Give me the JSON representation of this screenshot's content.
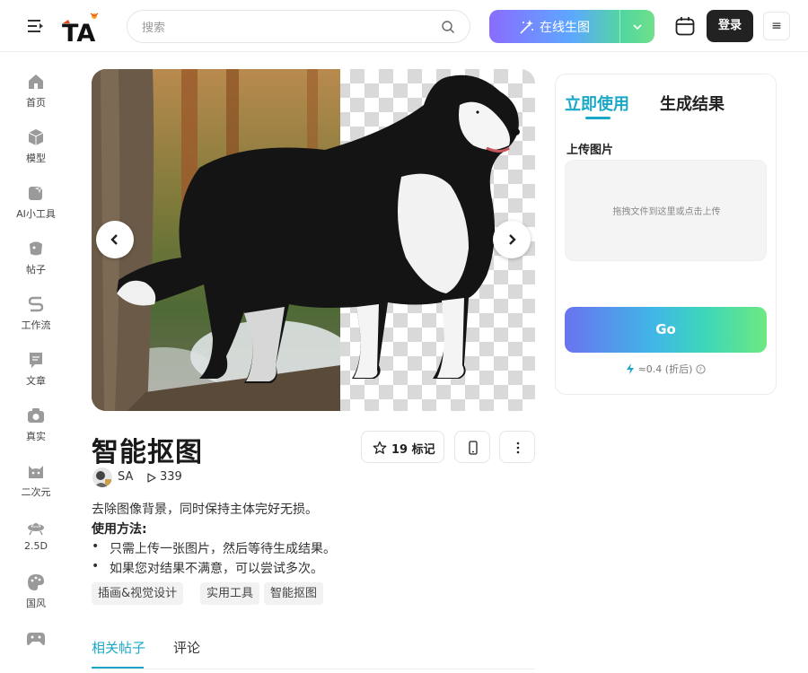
{
  "header": {
    "search_placeholder": "搜索",
    "generate_label": "在线生图",
    "login_label": "登录",
    "menu_icon": "≡",
    "logo_text": "TA"
  },
  "sidebar": {
    "items": [
      {
        "label": "首页",
        "icon": "home-icon"
      },
      {
        "label": "模型",
        "icon": "cube-icon"
      },
      {
        "label": "AI小工具",
        "icon": "ai-tool-icon"
      },
      {
        "label": "帖子",
        "icon": "post-icon"
      },
      {
        "label": "工作流",
        "icon": "workflow-icon"
      },
      {
        "label": "文章",
        "icon": "article-icon"
      },
      {
        "label": "真实",
        "icon": "camera-icon"
      },
      {
        "label": "二次元",
        "icon": "anime-cat-icon"
      },
      {
        "label": "2.5D",
        "icon": "ufo-icon"
      },
      {
        "label": "国风",
        "icon": "palette-icon"
      },
      {
        "label": "",
        "icon": "gamepad-icon"
      }
    ]
  },
  "main": {
    "title": "智能抠图",
    "bookmark": "19 标记",
    "author": "SA",
    "views": "339",
    "description": "去除图像背景，同时保持主体完好无损。",
    "usage_title": "使用方法:",
    "usage_items": [
      "只需上传一张图片，然后等待生成结果。",
      "如果您对结果不满意，可以尝试多次。"
    ],
    "tags": [
      "插画&视觉设计",
      "实用工具",
      "智能抠图"
    ],
    "tabs": {
      "related": "相关帖子",
      "comments": "评论"
    }
  },
  "panel": {
    "tab_use": "立即使用",
    "tab_result": "生成结果",
    "upload_label": "上传图片",
    "dropzone_text": "拖拽文件到这里或点击上传",
    "go_label": "Go",
    "cost": "≈0.4 (折后)"
  },
  "colors": {
    "accent": "#1ba8c8",
    "login_bg": "#222222"
  }
}
